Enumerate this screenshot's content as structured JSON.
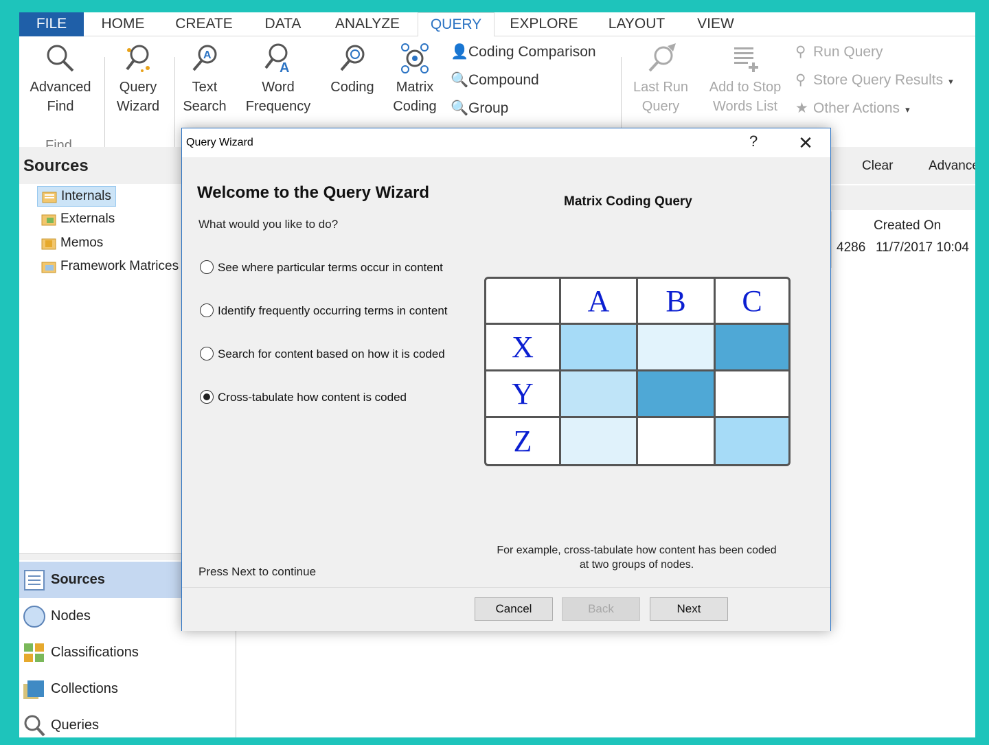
{
  "ribbon": {
    "tabs": [
      "FILE",
      "HOME",
      "CREATE",
      "DATA",
      "ANALYZE",
      "QUERY",
      "EXPLORE",
      "LAYOUT",
      "VIEW"
    ],
    "active_tab": "QUERY",
    "find_group": {
      "advanced_find": [
        "Advanced",
        "Find"
      ],
      "label": "Find"
    },
    "buttons": {
      "query_wizard": [
        "Query",
        "Wizard"
      ],
      "text_search": [
        "Text",
        "Search"
      ],
      "word_frequency": [
        "Word",
        "Frequency"
      ],
      "coding": [
        "Coding"
      ],
      "matrix_coding": [
        "Matrix",
        "Coding"
      ],
      "last_run_query": [
        "Last Run",
        "Query"
      ],
      "add_to_stop_words": [
        "Add to Stop",
        "Words List"
      ]
    },
    "small": {
      "coding_comparison": "Coding Comparison",
      "compound": "Compound",
      "group": "Group",
      "run_query": "Run Query",
      "store_query_results": "Store Query Results",
      "other_actions": "Other Actions"
    }
  },
  "navigation": {
    "title": "Sources",
    "tree": [
      {
        "label": "Internals",
        "selected": true
      },
      {
        "label": "Externals",
        "selected": false
      },
      {
        "label": "Memos",
        "selected": false
      },
      {
        "label": "Framework Matrices",
        "selected": false
      }
    ],
    "workspaces": [
      {
        "label": "Sources",
        "selected": true
      },
      {
        "label": "Nodes",
        "selected": false
      },
      {
        "label": "Classifications",
        "selected": false
      },
      {
        "label": "Collections",
        "selected": false
      },
      {
        "label": "Queries",
        "selected": false
      }
    ]
  },
  "list": {
    "clear_label": "Clear",
    "advanced_label": "Advance",
    "column_created_on": "Created On",
    "row_number": "4286",
    "row_created_on": "11/7/2017 10:04"
  },
  "dialog": {
    "title": "Query Wizard",
    "help": "?",
    "close": "✕",
    "heading": "Welcome to the Query Wizard",
    "question": "What would you like to do?",
    "options": [
      {
        "label": "See where particular terms occur in content",
        "selected": false
      },
      {
        "label": "Identify frequently occurring terms in content",
        "selected": false
      },
      {
        "label": "Search for content based on how it is coded",
        "selected": false
      },
      {
        "label": "Cross-tabulate how content is coded",
        "selected": true
      }
    ],
    "continue_hint": "Press Next to continue",
    "preview": {
      "title": "Matrix Coding Query",
      "columns": [
        "A",
        "B",
        "C"
      ],
      "rows": [
        "X",
        "Y",
        "Z"
      ],
      "cell_colors": [
        [
          "#a6dbf7",
          "#e2f3fc",
          "#4fa8d6"
        ],
        [
          "#bfe4f8",
          "#4fa8d6",
          "#ffffff"
        ],
        [
          "#e0f2fb",
          "#ffffff",
          "#a6dbf7"
        ]
      ],
      "caption": [
        "For example, cross-tabulate how content has been coded",
        "at two groups of nodes."
      ]
    },
    "buttons": {
      "cancel": "Cancel",
      "back": "Back",
      "next": "Next"
    }
  }
}
